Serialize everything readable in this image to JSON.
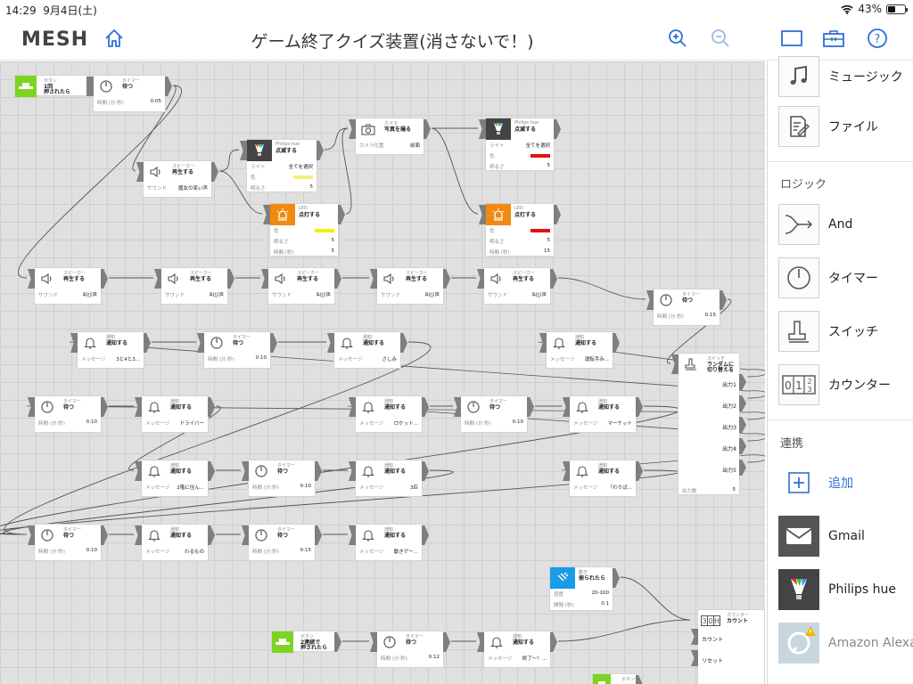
{
  "status": {
    "time": "14:29",
    "date": "9月4日(土)",
    "battery": "43%",
    "battery_level": 0.43
  },
  "header": {
    "logo": "MESH",
    "title": "ゲーム終了クイズ装置(消さないで！)"
  },
  "icons": {
    "home": "home-icon",
    "zoom_in": "zoom-in-icon",
    "zoom_out": "zoom-out-icon",
    "panel": "panel-icon",
    "toolbox": "toolbox-icon",
    "help": "help-icon"
  },
  "colors": {
    "accent": "#2f6fd6",
    "led": "#f08a10",
    "button": "#7ed321",
    "move": "#1a9be8",
    "grid": "#e0e0e0"
  },
  "tags": [
    {
      "id": "b1",
      "kind": "button",
      "sub": "ボタン",
      "name": "1回\n押されたら",
      "rows": []
    },
    {
      "id": "t1",
      "kind": "timer",
      "sub": "タイマー",
      "name": "待つ",
      "rows": [
        [
          "時間 (分:秒)",
          "0:05"
        ]
      ]
    },
    {
      "id": "s1",
      "kind": "speaker",
      "sub": "スピーカー",
      "name": "再生する",
      "rows": [
        [
          "サウンド",
          "魔女の笑い声"
        ]
      ]
    },
    {
      "id": "h1",
      "kind": "hue",
      "sub": "Philips hue",
      "name": "点滅する",
      "rows": [
        [
          "ライト",
          "全てを選択"
        ],
        [
          "色",
          ""
        ],
        [
          "明るさ",
          "5"
        ]
      ],
      "swatch": "#f6f07a"
    },
    {
      "id": "cam",
      "kind": "camera",
      "sub": "カメラ",
      "name": "写真を撮る",
      "rows": [
        [
          "カメラ位置",
          "前面"
        ]
      ]
    },
    {
      "id": "h2",
      "kind": "hue",
      "sub": "Philips hue",
      "name": "点滅する",
      "rows": [
        [
          "ライト",
          "全てを選択"
        ],
        [
          "色",
          ""
        ],
        [
          "明るさ",
          "5"
        ]
      ],
      "swatch": "#e81010"
    },
    {
      "id": "l1",
      "kind": "led",
      "sub": "LED",
      "name": "点灯する",
      "rows": [
        [
          "色",
          ""
        ],
        [
          "明るさ",
          "5"
        ],
        [
          "時間 (秒)",
          "5"
        ]
      ],
      "swatch": "#f2f000"
    },
    {
      "id": "l2",
      "kind": "led",
      "sub": "LED",
      "name": "点灯する",
      "rows": [
        [
          "色",
          ""
        ],
        [
          "明るさ",
          "5"
        ],
        [
          "時間 (秒)",
          "15"
        ]
      ],
      "swatch": "#e81010"
    },
    {
      "id": "sp1",
      "kind": "speaker",
      "sub": "スピーカー",
      "name": "再生する",
      "rows": [
        [
          "サウンド",
          "叫び声"
        ]
      ]
    },
    {
      "id": "sp2",
      "kind": "speaker",
      "sub": "スピーカー",
      "name": "再生する",
      "rows": [
        [
          "サウンド",
          "叫び声"
        ]
      ]
    },
    {
      "id": "sp3",
      "kind": "speaker",
      "sub": "スピーカー",
      "name": "再生する",
      "rows": [
        [
          "サウンド",
          "叫び声"
        ]
      ]
    },
    {
      "id": "sp4",
      "kind": "speaker",
      "sub": "スピーカー",
      "name": "再生する",
      "rows": [
        [
          "サウンド",
          "叫び声"
        ]
      ]
    },
    {
      "id": "sp5",
      "kind": "speaker",
      "sub": "スピーカー",
      "name": "再生する",
      "rows": [
        [
          "サウンド",
          "叫び声"
        ]
      ]
    },
    {
      "id": "t2",
      "kind": "timer",
      "sub": "タイマー",
      "name": "待つ",
      "rows": [
        [
          "時間 (分:秒)",
          "0:15"
        ]
      ]
    },
    {
      "id": "n1",
      "kind": "notify",
      "sub": "通知",
      "name": "通知する",
      "rows": [
        [
          "メッセージ",
          "3と4と3..."
        ]
      ]
    },
    {
      "id": "t3",
      "kind": "timer",
      "sub": "タイマー",
      "name": "待つ",
      "rows": [
        [
          "時間 (分:秒)",
          "0:10"
        ]
      ]
    },
    {
      "id": "n2",
      "kind": "notify",
      "sub": "通知",
      "name": "通知する",
      "rows": [
        [
          "メッセージ",
          "さしみ"
        ]
      ]
    },
    {
      "id": "n3",
      "kind": "notify",
      "sub": "通知",
      "name": "通知する",
      "rows": [
        [
          "メッセージ",
          "運転手み..."
        ]
      ]
    },
    {
      "id": "sw1",
      "kind": "switch",
      "sub": "スイッチ",
      "name": "ランダムに\n切り替える",
      "rows": [
        [
          "出力数",
          "5"
        ]
      ],
      "outputs": [
        "出力1",
        "出力2",
        "出力3",
        "出力4",
        "出力5"
      ]
    },
    {
      "id": "t4",
      "kind": "timer",
      "sub": "タイマー",
      "name": "待つ",
      "rows": [
        [
          "時間 (分:秒)",
          "0:10"
        ]
      ]
    },
    {
      "id": "n4",
      "kind": "notify",
      "sub": "通知",
      "name": "通知する",
      "rows": [
        [
          "メッセージ",
          "ドライバー"
        ]
      ]
    },
    {
      "id": "n5",
      "kind": "notify",
      "sub": "通知",
      "name": "通知する",
      "rows": [
        [
          "メッセージ",
          "ロケット..."
        ]
      ]
    },
    {
      "id": "t5",
      "kind": "timer",
      "sub": "タイマー",
      "name": "待つ",
      "rows": [
        [
          "時間 (分:秒)",
          "0:10"
        ]
      ]
    },
    {
      "id": "n6",
      "kind": "notify",
      "sub": "通知",
      "name": "通知する",
      "rows": [
        [
          "メッセージ",
          "マーケット"
        ]
      ]
    },
    {
      "id": "n7",
      "kind": "notify",
      "sub": "通知",
      "name": "通知する",
      "rows": [
        [
          "メッセージ",
          "2階に住ん..."
        ]
      ]
    },
    {
      "id": "t6",
      "kind": "timer",
      "sub": "タイマー",
      "name": "待つ",
      "rows": [
        [
          "時間 (分:秒)",
          "0:10"
        ]
      ]
    },
    {
      "id": "n8",
      "kind": "notify",
      "sub": "通知",
      "name": "通知する",
      "rows": [
        [
          "メッセージ",
          "3匹"
        ]
      ]
    },
    {
      "id": "n9",
      "kind": "notify",
      "sub": "通知",
      "name": "通知する",
      "rows": [
        [
          "メッセージ",
          "「わりば..."
        ]
      ]
    },
    {
      "id": "t7",
      "kind": "timer",
      "sub": "タイマー",
      "name": "待つ",
      "rows": [
        [
          "時間 (分:秒)",
          "0:10"
        ]
      ]
    },
    {
      "id": "n10",
      "kind": "notify",
      "sub": "通知",
      "name": "通知する",
      "rows": [
        [
          "メッセージ",
          "わるもの"
        ]
      ]
    },
    {
      "id": "t8",
      "kind": "timer",
      "sub": "タイマー",
      "name": "待つ",
      "rows": [
        [
          "時間 (分:秒)",
          "0:15"
        ]
      ]
    },
    {
      "id": "n11",
      "kind": "notify",
      "sub": "通知",
      "name": "通知する",
      "rows": [
        [
          "メッセージ",
          "動きゲー..."
        ]
      ]
    },
    {
      "id": "mv",
      "kind": "move",
      "sub": "動き",
      "name": "振られたら",
      "rows": [
        [
          "感度",
          "20-100"
        ],
        [
          "間隔 (秒)",
          "0.1"
        ]
      ]
    },
    {
      "id": "b2",
      "kind": "button",
      "sub": "ボタン",
      "name": "2連続で\n押されたら",
      "rows": []
    },
    {
      "id": "t9",
      "kind": "timer",
      "sub": "タイマー",
      "name": "待つ",
      "rows": [
        [
          "時間 (分:秒)",
          "0:12"
        ]
      ]
    },
    {
      "id": "n12",
      "kind": "notify",
      "sub": "通知",
      "name": "通知する",
      "rows": [
        [
          "メッセージ",
          "終了〜！..."
        ]
      ]
    },
    {
      "id": "cnt",
      "kind": "counter",
      "sub": "カウンター",
      "name": "カウント",
      "rows": [],
      "outputs": [
        "カウント",
        "リセット"
      ]
    },
    {
      "id": "b3",
      "kind": "button",
      "sub": "ボタン",
      "name": "",
      "rows": []
    }
  ],
  "palette": {
    "items_top": [
      {
        "label": "ミュージック",
        "icon": "music-icon"
      },
      {
        "label": "ファイル",
        "icon": "file-icon"
      }
    ],
    "logic_title": "ロジック",
    "logic": [
      {
        "label": "And",
        "icon": "and-icon"
      },
      {
        "label": "タイマー",
        "icon": "timer-icon"
      },
      {
        "label": "スイッチ",
        "icon": "switch-icon"
      },
      {
        "label": "カウンター",
        "icon": "counter-icon"
      }
    ],
    "link_title": "連携",
    "add_label": "追加",
    "links": [
      {
        "label": "Gmail",
        "icon": "gmail-icon"
      },
      {
        "label": "Philips hue",
        "icon": "hue-icon"
      },
      {
        "label": "Amazon Alexa",
        "icon": "alexa-icon"
      }
    ]
  }
}
